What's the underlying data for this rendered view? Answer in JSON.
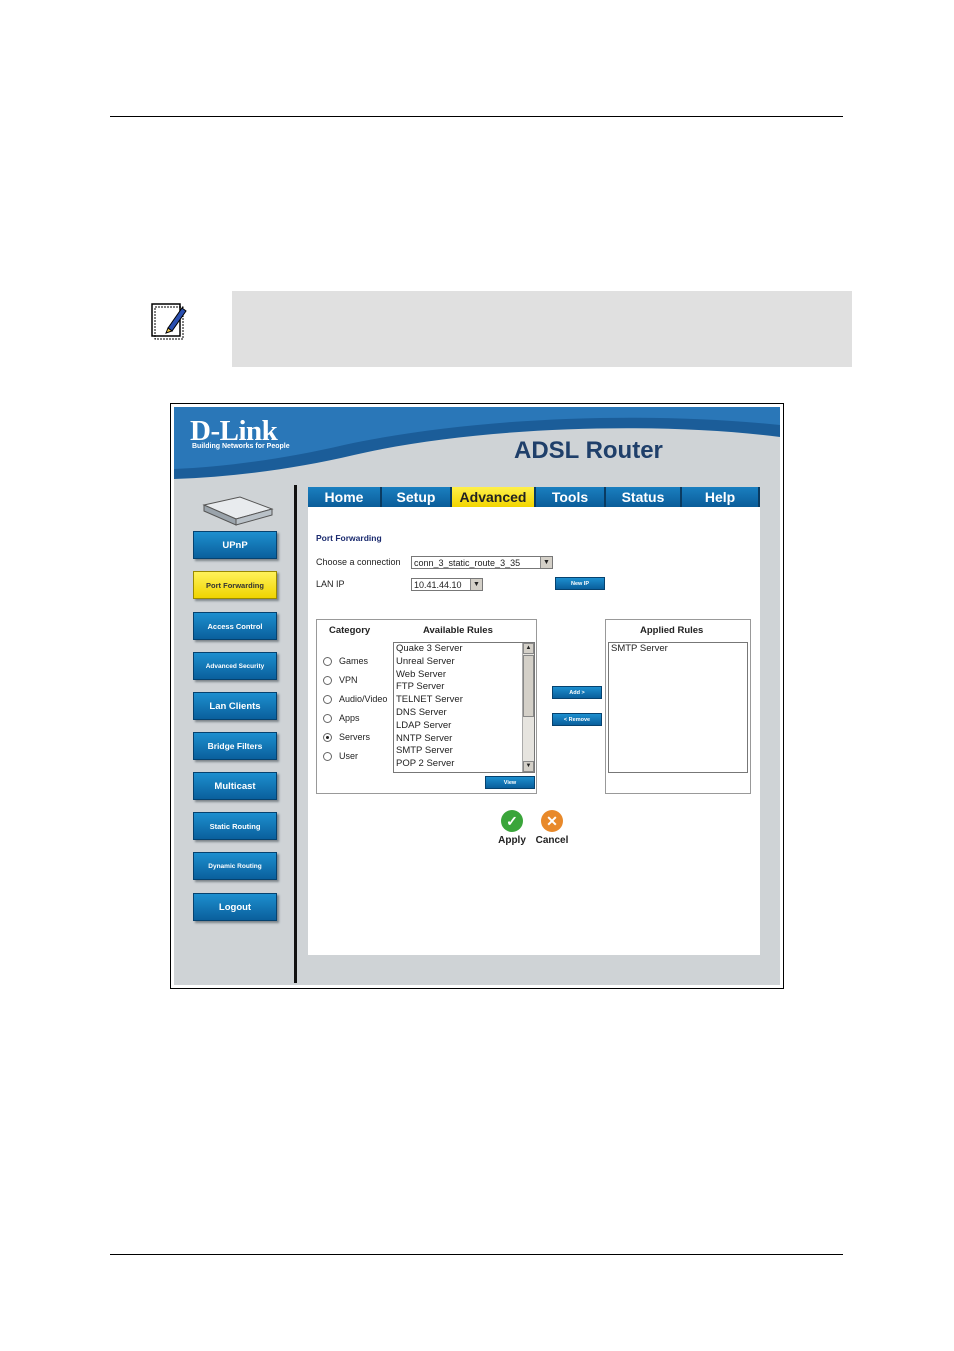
{
  "router": {
    "brand": "D-Link",
    "tagline": "Building Networks for People",
    "product": "ADSL Router",
    "sidebar": [
      "UPnP",
      "Port Forwarding",
      "Access Control",
      "Advanced Security",
      "Lan Clients",
      "Bridge Filters",
      "Multicast",
      "Static Routing",
      "Dynamic Routing",
      "Logout"
    ],
    "tabs": [
      "Home",
      "Setup",
      "Advanced",
      "Tools",
      "Status",
      "Help"
    ],
    "section_title": "Port Forwarding",
    "connection_label": "Choose a connection",
    "connection_value": "conn_3_static_route_3_35",
    "lan_ip_label": "LAN IP",
    "lan_ip_value": "10.41.44.10",
    "new_ip_label": "New IP",
    "category_header": "Category",
    "categories": [
      "Games",
      "VPN",
      "Audio/Video",
      "Apps",
      "Servers",
      "User"
    ],
    "selected_category": "Servers",
    "available_header": "Available Rules",
    "available_rules": [
      "Quake 3 Server",
      "Unreal Server",
      "Web Server",
      "FTP Server",
      "TELNET Server",
      "DNS Server",
      "LDAP Server",
      "NNTP Server",
      "SMTP Server",
      "POP 2 Server"
    ],
    "view_label": "View",
    "add_label": "Add >",
    "remove_label": "< Remove",
    "applied_header": "Applied Rules",
    "applied_rules": [
      "SMTP Server"
    ],
    "apply_label": "Apply",
    "cancel_label": "Cancel"
  }
}
